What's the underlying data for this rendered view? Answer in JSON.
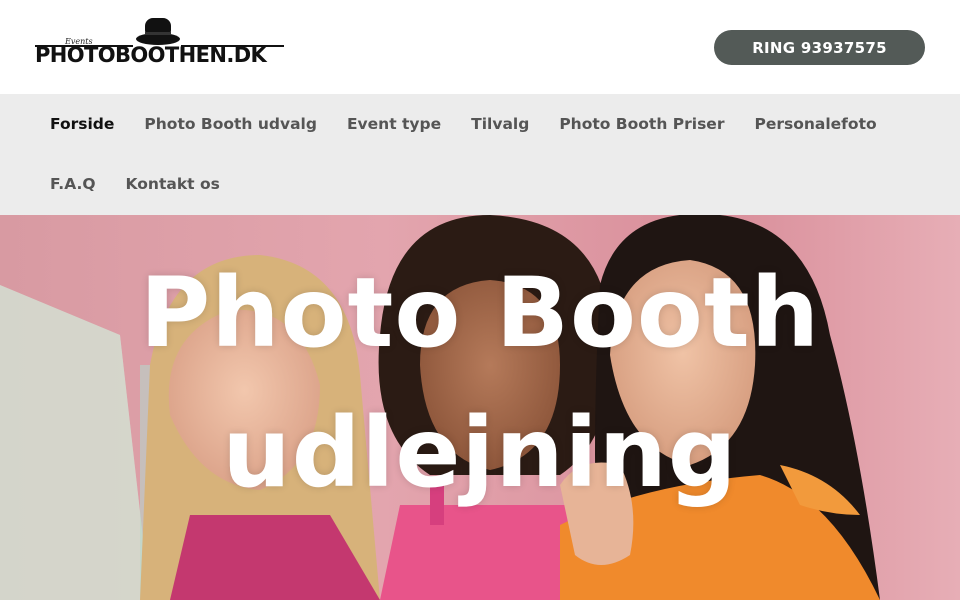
{
  "header": {
    "logo": {
      "wordmark": "PHOTOBOOTHEN.DK",
      "tagline": "Events"
    },
    "call_button": "RING 93937575"
  },
  "nav": {
    "items": [
      {
        "label": "Forside",
        "active": true
      },
      {
        "label": "Photo Booth udvalg",
        "active": false
      },
      {
        "label": "Event type",
        "active": false
      },
      {
        "label": "Tilvalg",
        "active": false
      },
      {
        "label": "Photo Booth Priser",
        "active": false
      },
      {
        "label": "Personalefoto",
        "active": false
      },
      {
        "label": "F.A.Q",
        "active": false
      },
      {
        "label": "Kontakt os",
        "active": false
      }
    ]
  },
  "hero": {
    "title_line1": "Photo Booth",
    "title_line2": "udlejning",
    "image": "three-women-smiling-photo"
  },
  "colors": {
    "call_button_bg": "#535a57",
    "nav_bg": "#ececec",
    "nav_active": "#111111",
    "nav_inactive": "#555555"
  }
}
